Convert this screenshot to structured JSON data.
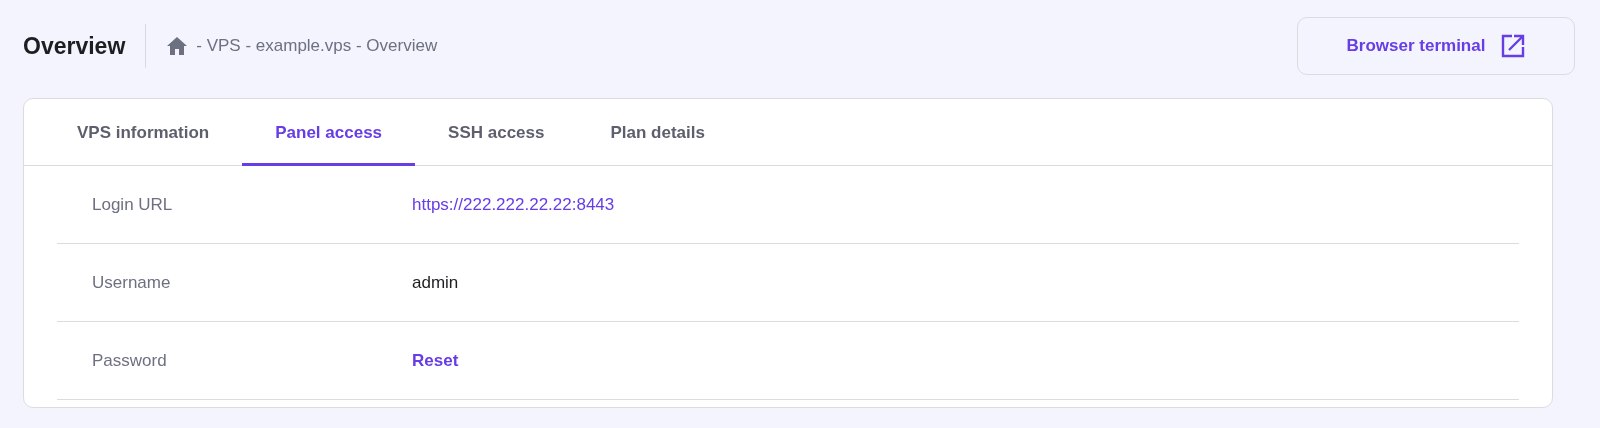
{
  "header": {
    "title": "Overview",
    "breadcrumb": "- VPS - example.vps - Overview",
    "action_button": "Browser terminal"
  },
  "tabs": [
    {
      "label": "VPS information",
      "selected": false
    },
    {
      "label": "Panel access",
      "selected": true
    },
    {
      "label": "SSH access",
      "selected": false
    },
    {
      "label": "Plan details",
      "selected": false
    }
  ],
  "rows": [
    {
      "label": "Login URL",
      "value": "https://222.222.22.22:8443",
      "kind": "link"
    },
    {
      "label": "Username",
      "value": "admin",
      "kind": "text"
    },
    {
      "label": "Password",
      "value": "Reset",
      "kind": "action"
    }
  ]
}
